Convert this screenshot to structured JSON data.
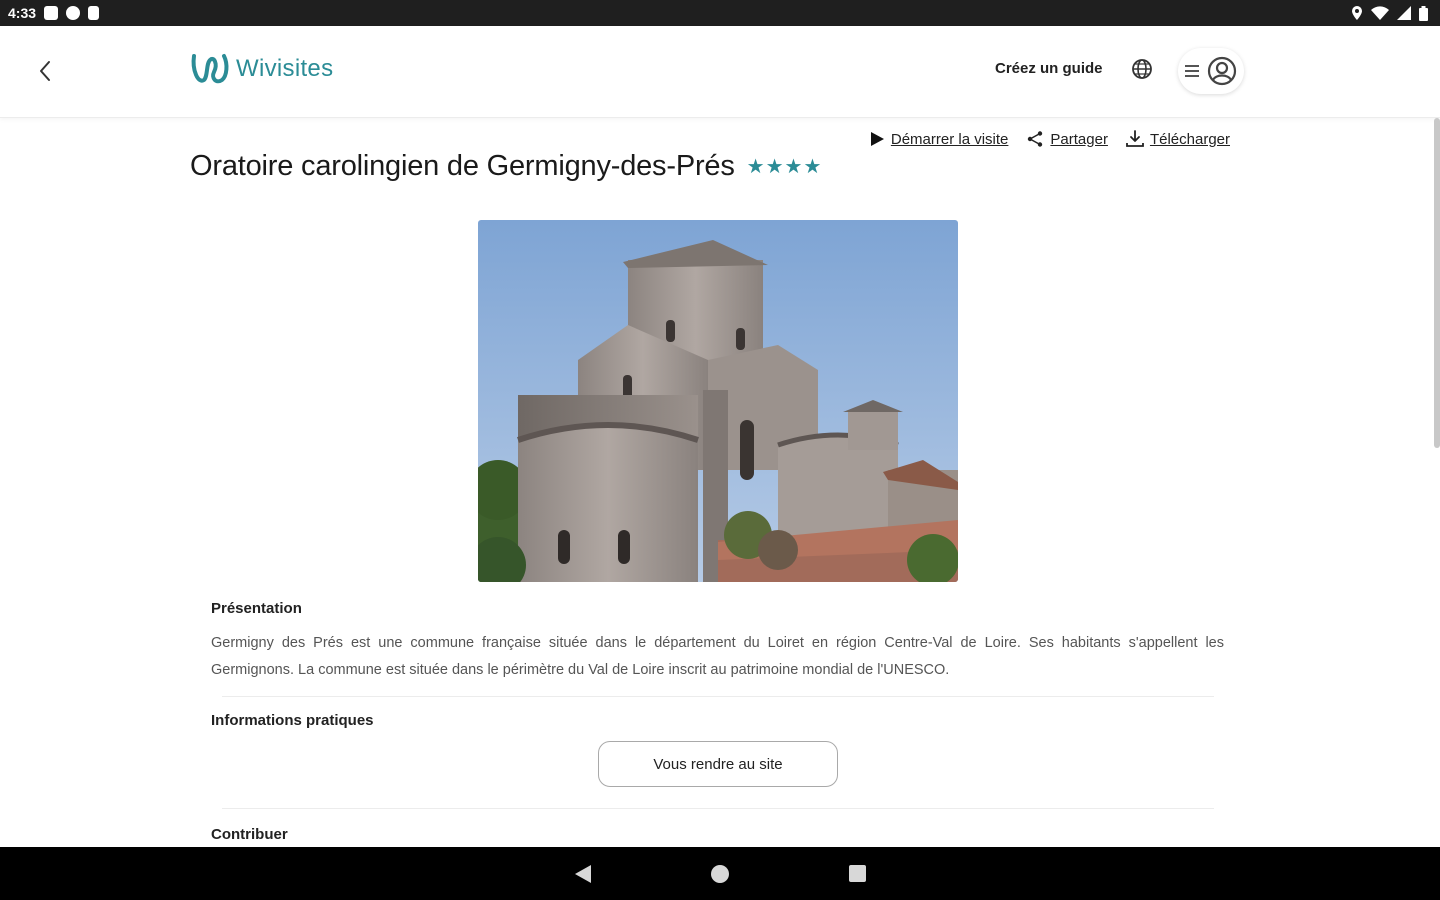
{
  "status_bar": {
    "time": "4:33",
    "icons_left": [
      "notification-icon",
      "app-icon",
      "sd-card-icon"
    ],
    "icons_right": [
      "location-icon",
      "wifi-icon",
      "signal-icon",
      "battery-icon"
    ]
  },
  "header": {
    "logo_text": "Wivisites",
    "create_guide": "Créez un guide",
    "brand_color": "#2b8c96"
  },
  "actions": {
    "start_visit": "Démarrer la visite",
    "share": "Partager",
    "download": "Télécharger"
  },
  "page": {
    "title": "Oratoire carolingien de Germigny-des-Prés",
    "stars": "★★★★",
    "rating": 4
  },
  "sections": {
    "presentation_label": "Présentation",
    "presentation_text": "Germigny des Prés est une commune française située dans le département du Loiret en région Centre-Val de Loire. Ses habitants s'appellent les Germignons. La commune est située dans le périmètre du Val de Loire inscrit au patrimoine mondial de l'UNESCO.",
    "practical_label": "Informations pratiques",
    "go_to_site_button": "Vous rendre au site",
    "contribute_label": "Contribuer"
  }
}
